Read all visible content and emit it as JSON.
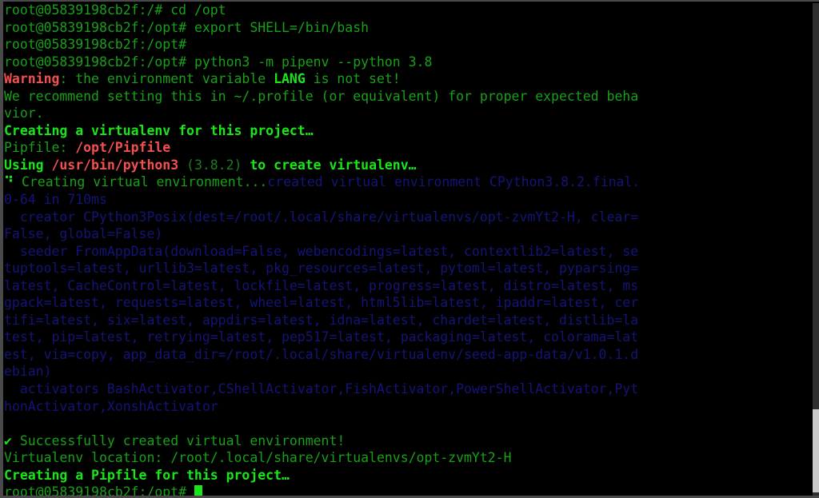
{
  "window": {
    "kind": "terminal-emulator",
    "background_color": "#000000",
    "border_color": "#4a4a4a",
    "columns": 104,
    "rows": 29
  },
  "colors": {
    "green": "#18a018",
    "green_bold": "#19e619",
    "green_dim": "#1e7a1e",
    "red_bold": "#f4504e",
    "blue": "#141478",
    "cursor": "#19e619"
  },
  "prompt": {
    "user_host_root": "root@05839198cb2f:/#",
    "user_host_opt": "root@05839198cb2f:/opt#"
  },
  "commands": {
    "cd": "cd /opt",
    "export": "export SHELL=/bin/bash",
    "pipenv": "python3 -m pipenv --python 3.8"
  },
  "scrollbar": {
    "name": "vertical-scrollbar",
    "thumb_position": "bottom"
  },
  "lines": [
    {
      "id": "line-01-cmd-cd",
      "spans": [
        {
          "text": "root@05839198cb2f:/# ",
          "cls": "c-green"
        },
        {
          "text": "cd /opt",
          "cls": "c-green"
        }
      ]
    },
    {
      "id": "line-02-cmd-export",
      "spans": [
        {
          "text": "root@05839198cb2f:/opt# ",
          "cls": "c-green"
        },
        {
          "text": "export SHELL=/bin/bash",
          "cls": "c-green"
        }
      ]
    },
    {
      "id": "line-03-empty-prompt",
      "spans": [
        {
          "text": "root@05839198cb2f:/opt# ",
          "cls": "c-green"
        }
      ]
    },
    {
      "id": "line-04-cmd-pipenv",
      "spans": [
        {
          "text": "root@05839198cb2f:/opt# ",
          "cls": "c-green"
        },
        {
          "text": "python3 -m pipenv --python 3.8",
          "cls": "c-green"
        }
      ]
    },
    {
      "id": "line-05-warning",
      "spans": [
        {
          "text": "Warning",
          "cls": "c-red-b"
        },
        {
          "text": ": the environment variable ",
          "cls": "c-green"
        },
        {
          "text": "LANG",
          "cls": "c-green-b"
        },
        {
          "text": " is not set!",
          "cls": "c-green"
        }
      ]
    },
    {
      "id": "line-06-recommend",
      "spans": [
        {
          "text": "We recommend setting this in ~/.profile (or equivalent) for proper expected beha",
          "cls": "c-green"
        }
      ]
    },
    {
      "id": "line-07-recommend-wrap",
      "spans": [
        {
          "text": "vior.",
          "cls": "c-green"
        }
      ]
    },
    {
      "id": "line-08-creating-virtualenv",
      "spans": [
        {
          "text": "Creating a virtualenv for this project…",
          "cls": "c-green-b"
        }
      ]
    },
    {
      "id": "line-09-pipfile",
      "spans": [
        {
          "text": "Pipfile: ",
          "cls": "c-green"
        },
        {
          "text": "/opt/Pipfile",
          "cls": "c-red-b"
        }
      ]
    },
    {
      "id": "line-10-using-python",
      "spans": [
        {
          "text": "Using ",
          "cls": "c-green-b"
        },
        {
          "text": "/usr/bin/python3",
          "cls": "c-red-b"
        },
        {
          "text": " ",
          "cls": "c-green"
        },
        {
          "text": "(3.8.2)",
          "cls": "c-green-dim"
        },
        {
          "text": " ",
          "cls": "c-green"
        },
        {
          "text": "to create virtualenv…",
          "cls": "c-green-b"
        }
      ]
    },
    {
      "id": "line-11-spinner-created",
      "spans": [
        {
          "text": "⠙ ",
          "cls": "c-green-b"
        },
        {
          "text": "Creating virtual environment...",
          "cls": "c-green"
        },
        {
          "text": "created virtual environment CPython3.8.2.final.",
          "cls": "c-blue"
        }
      ]
    },
    {
      "id": "line-12-created-wrap",
      "spans": [
        {
          "text": "0-64 in 710ms",
          "cls": "c-blue"
        }
      ]
    },
    {
      "id": "line-13-creator",
      "spans": [
        {
          "text": "  creator CPython3Posix(dest=/root/.local/share/virtualenvs/opt-zvmYt2-H, clear=",
          "cls": "c-blue"
        }
      ]
    },
    {
      "id": "line-14-creator-wrap",
      "spans": [
        {
          "text": "False, global=False)",
          "cls": "c-blue"
        }
      ]
    },
    {
      "id": "line-15-seeder",
      "spans": [
        {
          "text": "  seeder FromAppData(download=False, webencodings=latest, contextlib2=latest, se",
          "cls": "c-blue"
        }
      ]
    },
    {
      "id": "line-16-seeder-wrap-1",
      "spans": [
        {
          "text": "tuptools=latest, urllib3=latest, pkg_resources=latest, pytoml=latest, pyparsing=",
          "cls": "c-blue"
        }
      ]
    },
    {
      "id": "line-17-seeder-wrap-2",
      "spans": [
        {
          "text": "latest, CacheControl=latest, lockfile=latest, progress=latest, distro=latest, ms",
          "cls": "c-blue"
        }
      ]
    },
    {
      "id": "line-18-seeder-wrap-3",
      "spans": [
        {
          "text": "gpack=latest, requests=latest, wheel=latest, html5lib=latest, ipaddr=latest, cer",
          "cls": "c-blue"
        }
      ]
    },
    {
      "id": "line-19-seeder-wrap-4",
      "spans": [
        {
          "text": "tifi=latest, six=latest, appdirs=latest, idna=latest, chardet=latest, distlib=la",
          "cls": "c-blue"
        }
      ]
    },
    {
      "id": "line-20-seeder-wrap-5",
      "spans": [
        {
          "text": "test, pip=latest, retrying=latest, pep517=latest, packaging=latest, colorama=lat",
          "cls": "c-blue"
        }
      ]
    },
    {
      "id": "line-21-seeder-wrap-6",
      "spans": [
        {
          "text": "est, via=copy, app_data_dir=/root/.local/share/virtualenv/seed-app-data/v1.0.1.d",
          "cls": "c-blue"
        }
      ]
    },
    {
      "id": "line-22-seeder-wrap-7",
      "spans": [
        {
          "text": "ebian)",
          "cls": "c-blue"
        }
      ]
    },
    {
      "id": "line-23-activators",
      "spans": [
        {
          "text": "  activators BashActivator,CShellActivator,FishActivator,PowerShellActivator,Pyt",
          "cls": "c-blue"
        }
      ]
    },
    {
      "id": "line-24-activators-wrap",
      "spans": [
        {
          "text": "honActivator,XonshActivator",
          "cls": "c-blue"
        }
      ]
    },
    {
      "id": "line-25-blank",
      "spans": [
        {
          "text": "",
          "cls": "c-green"
        }
      ]
    },
    {
      "id": "line-26-success",
      "spans": [
        {
          "text": "✔",
          "cls": "c-green-b"
        },
        {
          "text": " Successfully created virtual environment!",
          "cls": "c-green"
        }
      ]
    },
    {
      "id": "line-27-venv-location",
      "spans": [
        {
          "text": "Virtualenv location: /root/.local/share/virtualenvs/opt-zvmYt2-H",
          "cls": "c-green"
        }
      ]
    },
    {
      "id": "line-28-creating-pipfile",
      "spans": [
        {
          "text": "Creating a Pipfile for this project…",
          "cls": "c-green-b"
        }
      ]
    },
    {
      "id": "line-29-final-prompt",
      "spans": [
        {
          "text": "root@05839198cb2f:/opt# ",
          "cls": "c-green"
        },
        {
          "text": "",
          "cls": "cursor"
        }
      ]
    }
  ]
}
